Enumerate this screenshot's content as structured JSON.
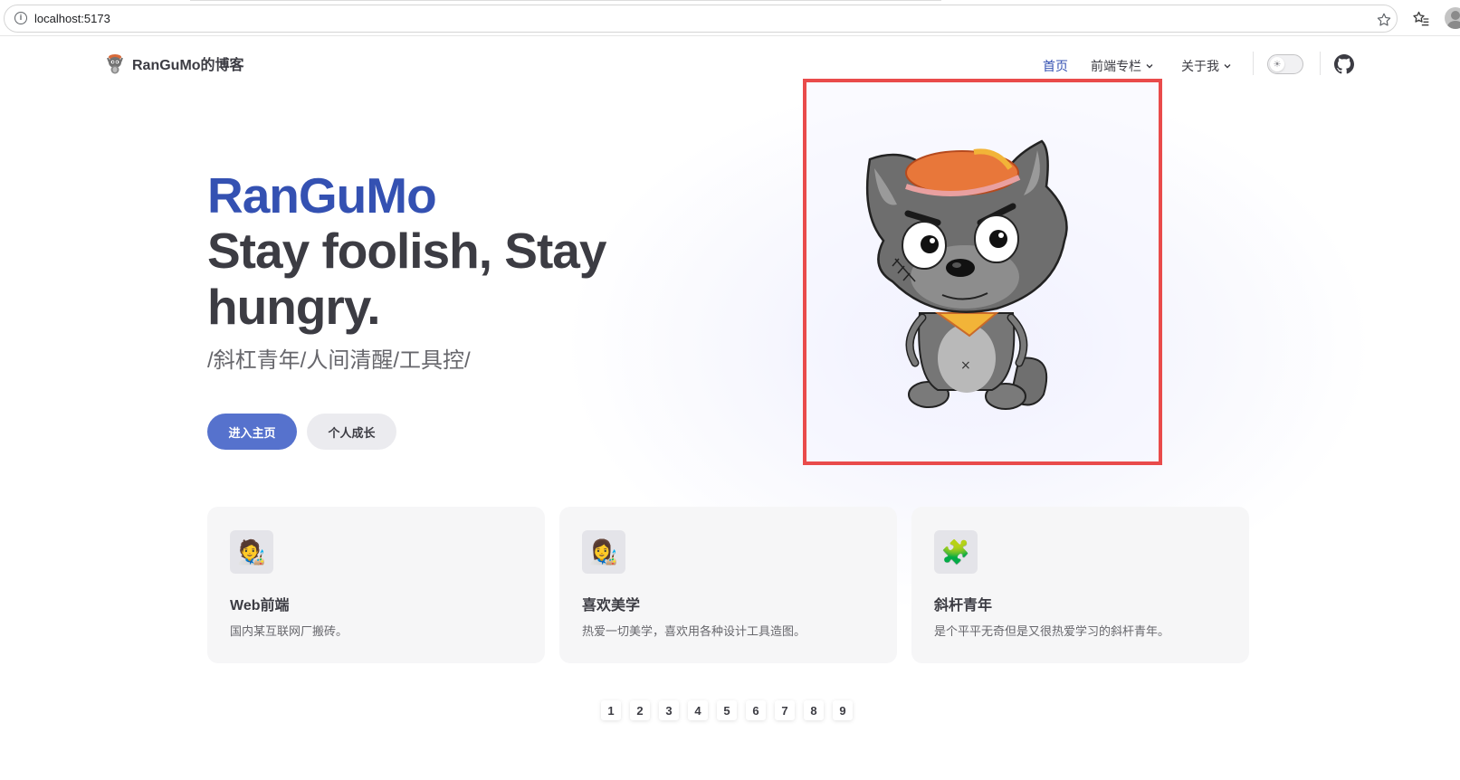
{
  "browser": {
    "url": "localhost:5173",
    "icons": [
      "info-icon",
      "star-icon",
      "favorites-icon",
      "profile-icon"
    ]
  },
  "nav": {
    "brand_title": "RanGuMo的博客",
    "brand_icon": "wolf-logo-icon",
    "home": "首页",
    "frontend": "前端专栏",
    "about": "关于我",
    "active_color": "#3451b2"
  },
  "hero": {
    "name": "RanGuMo",
    "text": "Stay foolish, Stay hungry.",
    "tagline": "/斜杠青年/人间清醒/工具控/",
    "actions": {
      "primary": "进入主页",
      "secondary": "个人成长"
    },
    "image": "grey-wolf-cartoon",
    "highlight_color": "#e94b4b"
  },
  "features": [
    {
      "icon": "🧑‍🎨",
      "title": "Web前端",
      "desc": "国内某互联网厂搬砖。"
    },
    {
      "icon": "👩‍🎨",
      "title": "喜欢美学",
      "desc": "热爱一切美学，喜欢用各种设计工具造图。"
    },
    {
      "icon": "🧩",
      "title": "斜杆青年",
      "desc": "是个平平无奇但是又很热爱学习的斜杆青年。"
    }
  ],
  "pagination": [
    "1",
    "2",
    "3",
    "4",
    "5",
    "6",
    "7",
    "8",
    "9"
  ]
}
